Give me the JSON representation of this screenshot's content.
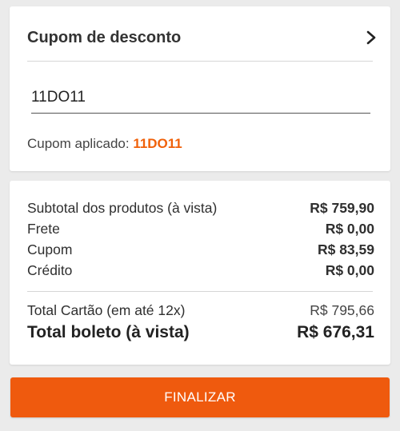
{
  "coupon": {
    "title": "Cupom de desconto",
    "input_value": "11DO11",
    "applied_label": "Cupom aplicado:",
    "applied_code": "11DO11"
  },
  "summary": {
    "rows": [
      {
        "label": "Subtotal dos produtos (à vista)",
        "value": "R$ 759,90"
      },
      {
        "label": "Frete",
        "value": "R$ 0,00"
      },
      {
        "label": "Cupom",
        "value": "R$ 83,59"
      },
      {
        "label": "Crédito",
        "value": "R$ 0,00"
      }
    ],
    "total_card": {
      "label": "Total Cartão (em até 12x)",
      "value": "R$ 795,66"
    },
    "total_boleto": {
      "label": "Total boleto (à vista)",
      "value": "R$ 676,31"
    }
  },
  "actions": {
    "finalize_label": "FINALIZAR"
  },
  "colors": {
    "accent": "#ef5a0e",
    "applied_code": "#f0610a",
    "background": "#ebebeb"
  },
  "icons": {
    "coupon_expand": "chevron-right-icon"
  }
}
